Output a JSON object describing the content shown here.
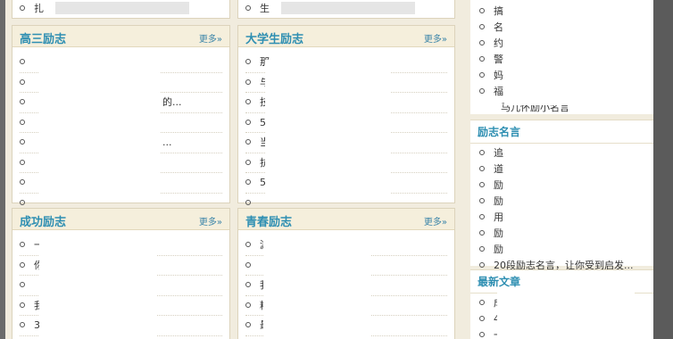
{
  "top_row": {
    "left": "扎",
    "middle": "生"
  },
  "panels": {
    "gaosan": {
      "title": "高三励志",
      "more": "更多»",
      "items": [
        "",
        "",
        "的...",
        "",
        "...",
        "",
        "",
        ""
      ]
    },
    "daxuesheng": {
      "title": "大学生励志",
      "more": "更多»",
      "items": [
        "那",
        "与",
        "技",
        "5",
        "当",
        "抗",
        "5",
        ""
      ]
    },
    "chenggong": {
      "title": "成功励志",
      "more": "更多»",
      "items": [
        "一",
        "你",
        "",
        "我",
        "3",
        ""
      ]
    },
    "qingchun": {
      "title": "青春励志",
      "more": "更多»",
      "items": [
        "游",
        "",
        "我",
        "粉",
        "最",
        "",
        ""
      ]
    }
  },
  "sidebar": {
    "top_block": {
      "items": [
        "搞",
        "名",
        "约",
        "警",
        "妈",
        "福",
        "马儿怀励小名言"
      ]
    },
    "lizhi_mingyan": {
      "title": "励志名言",
      "items": [
        "追",
        "道",
        "励",
        "励",
        "用",
        "励",
        "励",
        "20段励志名言，让你受到启发..."
      ]
    },
    "zuixin_wenzhang": {
      "title": "最新文章",
      "items": [
        "成",
        "40",
        "一",
        ""
      ]
    }
  }
}
